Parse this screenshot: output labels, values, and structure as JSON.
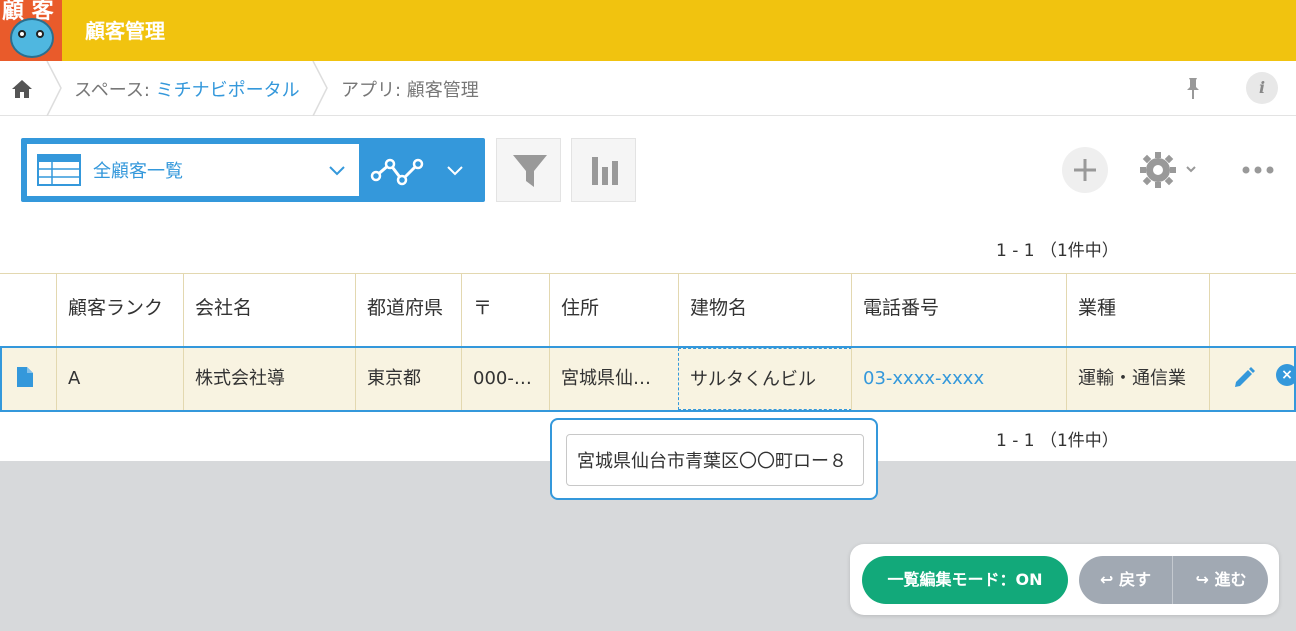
{
  "header": {
    "icon_text": "顧 客",
    "title": "顧客管理",
    "accent": "#f1c30f"
  },
  "breadcrumb": {
    "space_prefix": "スペース: ",
    "space_name": "ミチナビポータル",
    "app_label": "アプリ: 顧客管理"
  },
  "toolbar": {
    "view_name": "全顧客一覧",
    "pager_text": "1 - 1 （1件中）"
  },
  "table": {
    "columns": [
      "顧客ランク",
      "会社名",
      "都道府県",
      "〒",
      "住所",
      "建物名",
      "電話番号",
      "業種"
    ],
    "row": {
      "rank": "A",
      "company": "株式会社導",
      "prefecture": "東京都",
      "postal": "000-…",
      "address": "宮城県仙…",
      "building": "サルタくんビル",
      "phone": "03-xxxx-xxxx",
      "industry": "運輸・通信業"
    }
  },
  "popup": {
    "value": "宮城県仙台市青葉区〇〇町ロー８"
  },
  "bottom": {
    "mode_label": "一覧編集モード：ON",
    "undo_label": "↩ 戻す",
    "redo_label": "↪ 進む"
  },
  "colors": {
    "accent": "#3498db",
    "header": "#f1c30f",
    "mode_on": "#12a97a"
  }
}
